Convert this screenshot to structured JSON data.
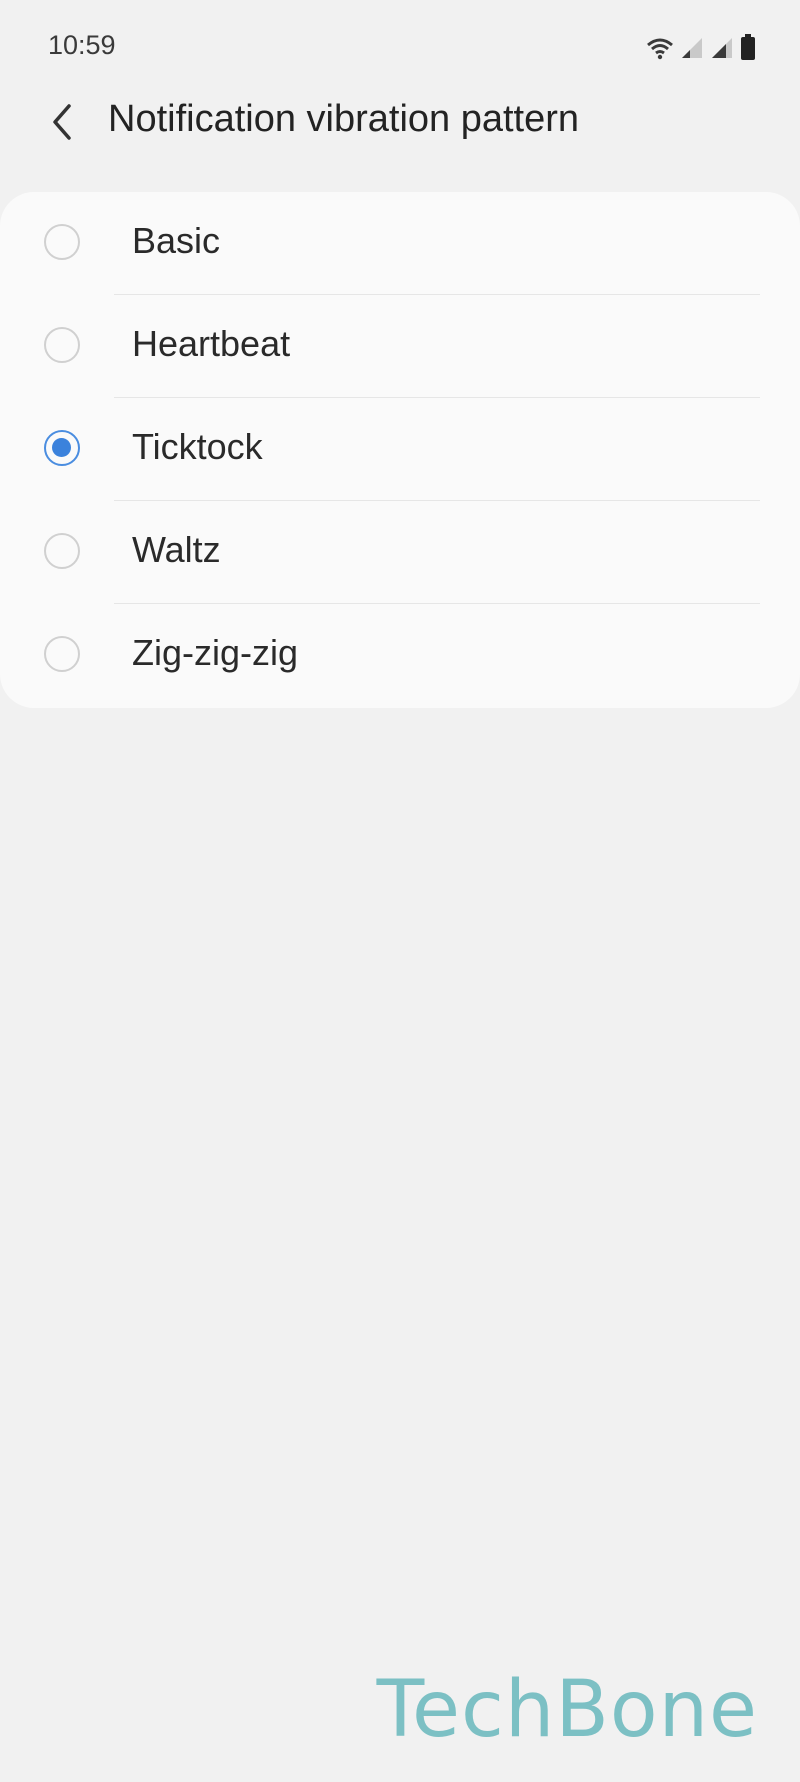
{
  "status_bar": {
    "time": "10:59"
  },
  "header": {
    "back_icon": "chevron-left-icon",
    "title": "Notification vibration pattern"
  },
  "options": [
    {
      "label": "Basic",
      "selected": false
    },
    {
      "label": "Heartbeat",
      "selected": false
    },
    {
      "label": "Ticktock",
      "selected": true
    },
    {
      "label": "Waltz",
      "selected": false
    },
    {
      "label": "Zig-zig-zig",
      "selected": false
    }
  ],
  "watermark": {
    "text": "TechBone",
    "color": "#7cc0c4"
  },
  "colors": {
    "accent": "#3b82dc",
    "background": "#f1f1f1",
    "card": "#fafafa"
  }
}
